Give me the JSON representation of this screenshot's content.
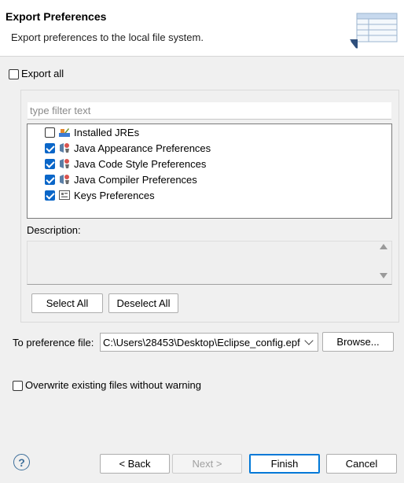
{
  "header": {
    "title": "Export Preferences",
    "subtitle": "Export preferences to the local file system."
  },
  "export_all": {
    "label": "Export all",
    "checked": false
  },
  "filter": {
    "placeholder": "type filter text",
    "value": ""
  },
  "tree": {
    "items": [
      {
        "label": "Installed JREs",
        "checked": false,
        "icon": "jre-icon"
      },
      {
        "label": "Java Appearance Preferences",
        "checked": true,
        "icon": "preference-node-icon"
      },
      {
        "label": "Java Code Style Preferences",
        "checked": true,
        "icon": "preference-node-icon"
      },
      {
        "label": "Java Compiler Preferences",
        "checked": true,
        "icon": "preference-node-icon"
      },
      {
        "label": "Keys Preferences",
        "checked": true,
        "icon": "keys-icon"
      }
    ]
  },
  "description": {
    "label": "Description:",
    "text": ""
  },
  "buttons": {
    "select_all": "Select All",
    "deselect_all": "Deselect All",
    "browse": "Browse...",
    "back": "< Back",
    "next": "Next >",
    "finish": "Finish",
    "cancel": "Cancel",
    "help": "?"
  },
  "preference_file": {
    "label": "To preference file:",
    "value": "C:\\Users\\28453\\Desktop\\Eclipse_config.epf"
  },
  "overwrite": {
    "label": "Overwrite existing files without warning",
    "checked": false
  },
  "colors": {
    "accent": "#0a66c8",
    "default_button_border": "#0078d7",
    "help_icon": "#3c6e9a"
  }
}
